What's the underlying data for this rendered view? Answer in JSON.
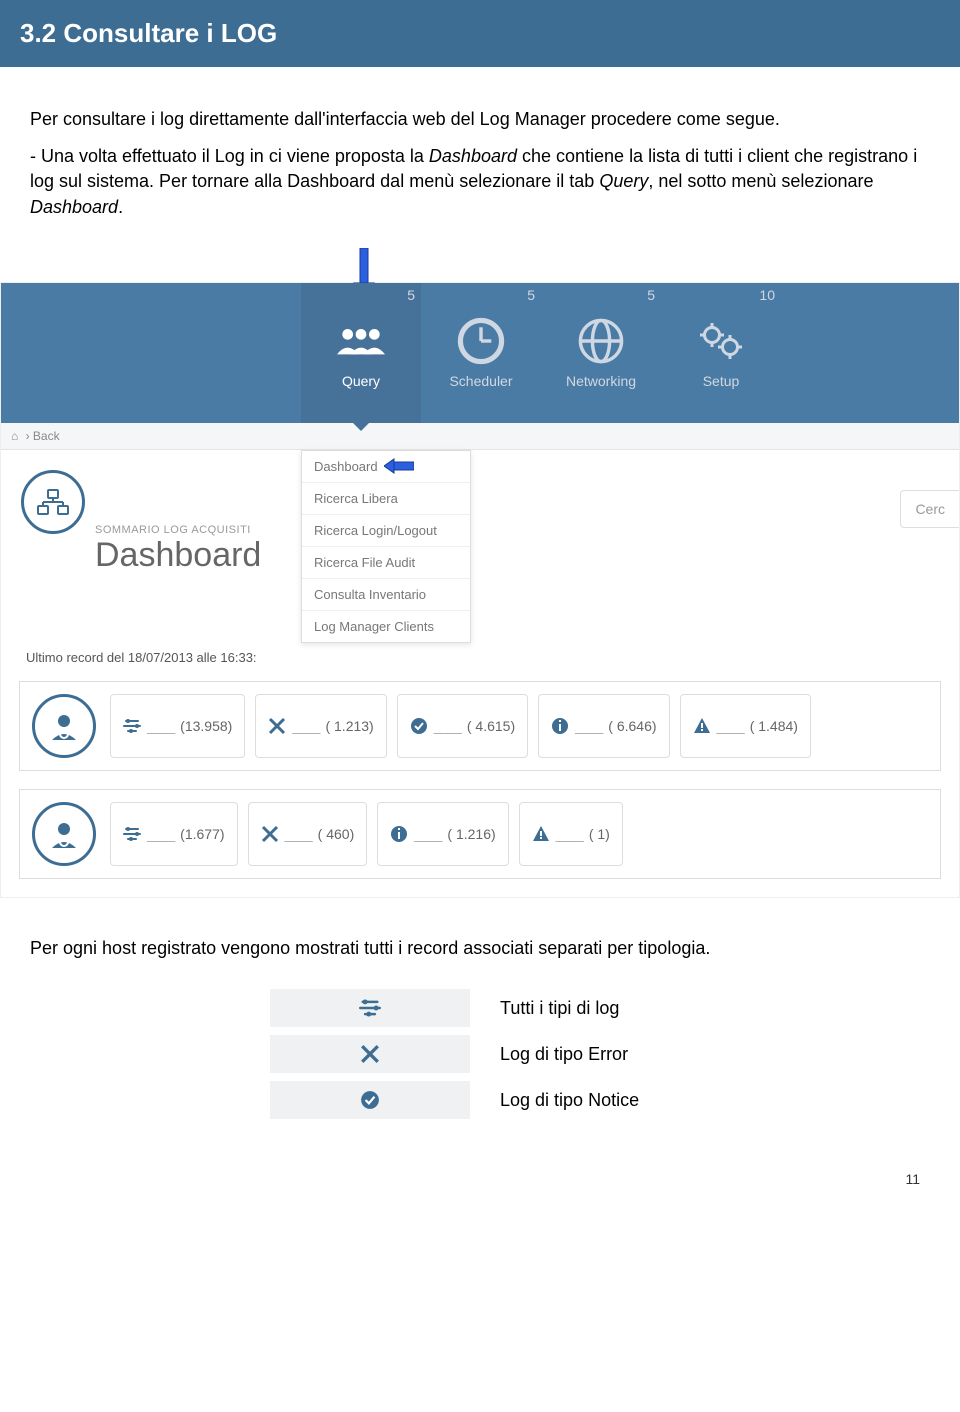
{
  "section_title": "3.2 Consultare i LOG",
  "intro_para": "Per consultare i log direttamente dall'interfaccia web del Log Manager procedere come segue.",
  "proc_prefix": "- Una volta effettuato il Log in ci viene proposta la ",
  "proc_italic1": "Dashboard",
  "proc_mid": " che contiene la lista di tutti i client che registrano i log sul sistema. Per tornare alla Dashboard dal menù selezionare il tab ",
  "proc_italic2": "Query",
  "proc_mid2": ", nel sotto menù selezionare ",
  "proc_italic3": "Dashboard",
  "proc_end": ".",
  "topnav": [
    {
      "label": "Query",
      "badge": "5"
    },
    {
      "label": "Scheduler",
      "badge": "5"
    },
    {
      "label": "Networking",
      "badge": "5"
    },
    {
      "label": "Setup",
      "badge": "10"
    }
  ],
  "breadcrumb_back": "Back",
  "dash_subtitle": "SOMMARIO LOG ACQUISITI",
  "dash_title": "Dashboard",
  "dropdown": [
    "Dashboard",
    "Ricerca Libera",
    "Ricerca Login/Logout",
    "Ricerca File Audit",
    "Consulta Inventario",
    "Log Manager Clients"
  ],
  "search_placeholder": "Cerc",
  "record_time": "Ultimo record del 18/07/2013 alle 16:33:",
  "host1": [
    {
      "icon": "all",
      "value": "(13.958)"
    },
    {
      "icon": "error",
      "value": "( 1.213)"
    },
    {
      "icon": "notice",
      "value": "( 4.615)"
    },
    {
      "icon": "info",
      "value": "( 6.646)"
    },
    {
      "icon": "warn",
      "value": "( 1.484)"
    }
  ],
  "host2": [
    {
      "icon": "all",
      "value": "(1.677)"
    },
    {
      "icon": "error",
      "value": "( 460)"
    },
    {
      "icon": "info",
      "value": "( 1.216)"
    },
    {
      "icon": "warn",
      "value": "( 1)"
    }
  ],
  "below_para": "Per ogni host registrato vengono mostrati tutti i record associati separati per tipologia.",
  "legend": [
    {
      "icon": "all",
      "label": "Tutti i tipi di log"
    },
    {
      "icon": "error",
      "label": "Log di tipo Error"
    },
    {
      "icon": "notice",
      "label": "Log di tipo Notice"
    }
  ],
  "page_num": "11"
}
